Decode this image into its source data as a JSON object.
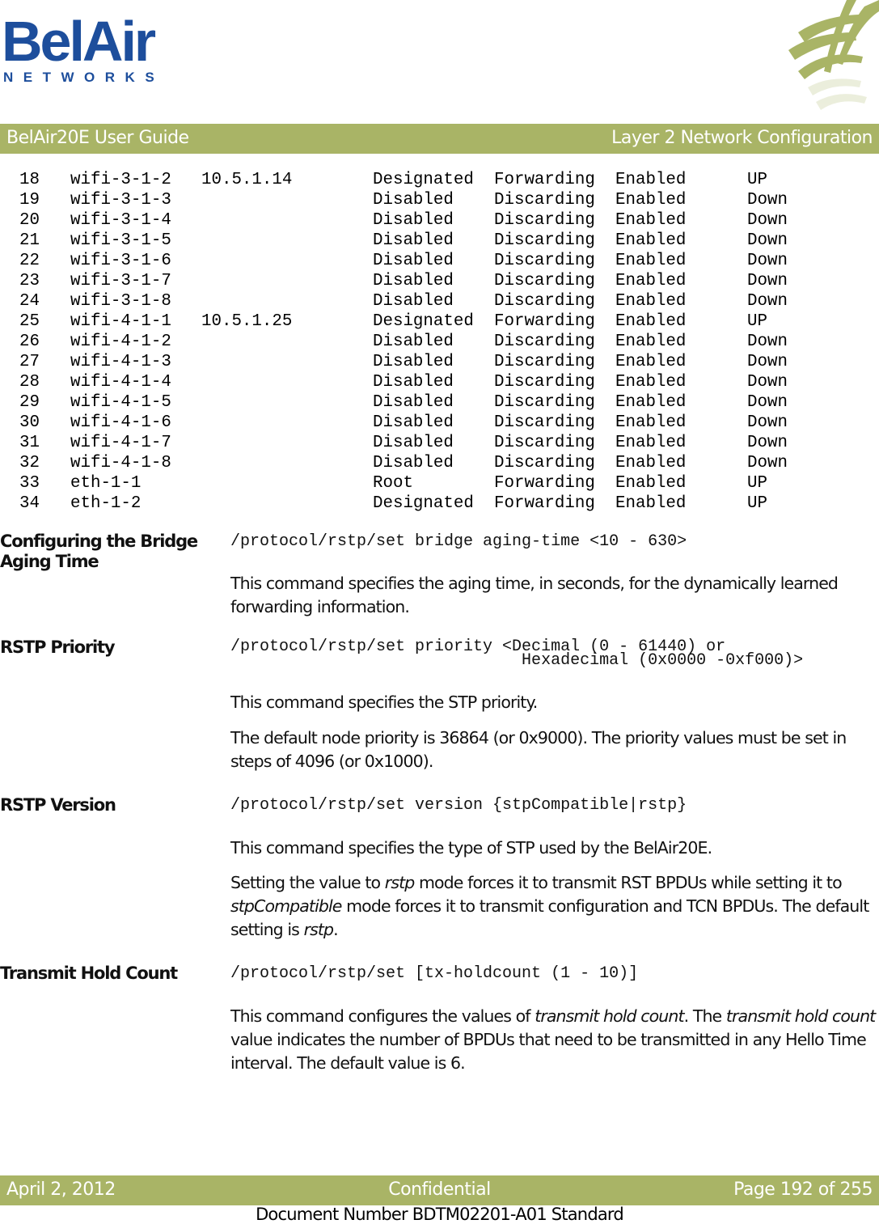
{
  "logo": {
    "main": "BelAir",
    "sub": "NETWORKS"
  },
  "header": {
    "left": "BelAir20E User Guide",
    "right": "Layer 2 Network Configuration"
  },
  "port_table": {
    "rows": [
      {
        "num": "18",
        "iface": "wifi-3-1-2",
        "ip": "10.5.1.14",
        "role": "Designated",
        "state": "Forwarding",
        "enabled": "Enabled",
        "link": "UP"
      },
      {
        "num": "19",
        "iface": "wifi-3-1-3",
        "ip": "",
        "role": "Disabled",
        "state": "Discarding",
        "enabled": "Enabled",
        "link": "Down"
      },
      {
        "num": "20",
        "iface": "wifi-3-1-4",
        "ip": "",
        "role": "Disabled",
        "state": "Discarding",
        "enabled": "Enabled",
        "link": "Down"
      },
      {
        "num": "21",
        "iface": "wifi-3-1-5",
        "ip": "",
        "role": "Disabled",
        "state": "Discarding",
        "enabled": "Enabled",
        "link": "Down"
      },
      {
        "num": "22",
        "iface": "wifi-3-1-6",
        "ip": "",
        "role": "Disabled",
        "state": "Discarding",
        "enabled": "Enabled",
        "link": "Down"
      },
      {
        "num": "23",
        "iface": "wifi-3-1-7",
        "ip": "",
        "role": "Disabled",
        "state": "Discarding",
        "enabled": "Enabled",
        "link": "Down"
      },
      {
        "num": "24",
        "iface": "wifi-3-1-8",
        "ip": "",
        "role": "Disabled",
        "state": "Discarding",
        "enabled": "Enabled",
        "link": "Down"
      },
      {
        "num": "25",
        "iface": "wifi-4-1-1",
        "ip": "10.5.1.25",
        "role": "Designated",
        "state": "Forwarding",
        "enabled": "Enabled",
        "link": "UP"
      },
      {
        "num": "26",
        "iface": "wifi-4-1-2",
        "ip": "",
        "role": "Disabled",
        "state": "Discarding",
        "enabled": "Enabled",
        "link": "Down"
      },
      {
        "num": "27",
        "iface": "wifi-4-1-3",
        "ip": "",
        "role": "Disabled",
        "state": "Discarding",
        "enabled": "Enabled",
        "link": "Down"
      },
      {
        "num": "28",
        "iface": "wifi-4-1-4",
        "ip": "",
        "role": "Disabled",
        "state": "Discarding",
        "enabled": "Enabled",
        "link": "Down"
      },
      {
        "num": "29",
        "iface": "wifi-4-1-5",
        "ip": "",
        "role": "Disabled",
        "state": "Discarding",
        "enabled": "Enabled",
        "link": "Down"
      },
      {
        "num": "30",
        "iface": "wifi-4-1-6",
        "ip": "",
        "role": "Disabled",
        "state": "Discarding",
        "enabled": "Enabled",
        "link": "Down"
      },
      {
        "num": "31",
        "iface": "wifi-4-1-7",
        "ip": "",
        "role": "Disabled",
        "state": "Discarding",
        "enabled": "Enabled",
        "link": "Down"
      },
      {
        "num": "32",
        "iface": "wifi-4-1-8",
        "ip": "",
        "role": "Disabled",
        "state": "Discarding",
        "enabled": "Enabled",
        "link": "Down"
      },
      {
        "num": "33",
        "iface": "eth-1-1",
        "ip": "",
        "role": "Root",
        "state": "Forwarding",
        "enabled": "Enabled",
        "link": "UP"
      },
      {
        "num": "34",
        "iface": "eth-1-2",
        "ip": "",
        "role": "Designated",
        "state": "Forwarding",
        "enabled": "Enabled",
        "link": "UP"
      }
    ]
  },
  "sections": {
    "aging": {
      "label_line1": "Configuring the Bridge",
      "label_line2": "Aging Time",
      "command": "/protocol/rstp/set bridge aging-time <10 - 630>",
      "para1": "This command specifies the aging time, in seconds, for the dynamically learned forwarding information."
    },
    "priority": {
      "label": "RSTP Priority",
      "command_line1": "/protocol/rstp/set priority <Decimal (0 - 61440) or",
      "command_line2": "                              Hexadecimal (0x0000 -0xf000)>",
      "para1": "This command specifies the STP priority.",
      "para2": "The default node priority is 36864 (or 0x9000). The priority values must be set in steps of 4096 (or 0x1000)."
    },
    "version": {
      "label": "RSTP Version",
      "command": "/protocol/rstp/set version {stpCompatible|rstp}",
      "para1": "This command specifies the type of STP used by the BelAir20E.",
      "para2_a": "Setting the value to ",
      "para2_em1": "rstp",
      "para2_b": " mode forces it to transmit RST BPDUs while setting it to ",
      "para2_em2": "stpCompatible",
      "para2_c": " mode forces it to transmit configuration and TCN BPDUs. The default setting is ",
      "para2_em3": "rstp",
      "para2_d": "."
    },
    "holdcount": {
      "label": "Transmit Hold Count",
      "command": "/protocol/rstp/set [tx-holdcount (1 - 10)]",
      "para1_a": "This command configures the values of ",
      "para1_em1": "transmit hold count",
      "para1_b": ". The ",
      "para1_em2": "transmit hold count",
      "para1_c": " value indicates the number of BPDUs that need to be transmitted in any Hello Time interval. The default value is 6."
    }
  },
  "footer": {
    "date": "April 2, 2012",
    "classification": "Confidential",
    "page": "Page 192 of 255",
    "doc_number": "Document Number BDTM02201-A01 Standard"
  },
  "colors": {
    "bar": "#a9b466",
    "logo_blue": "#1d4e9c"
  }
}
